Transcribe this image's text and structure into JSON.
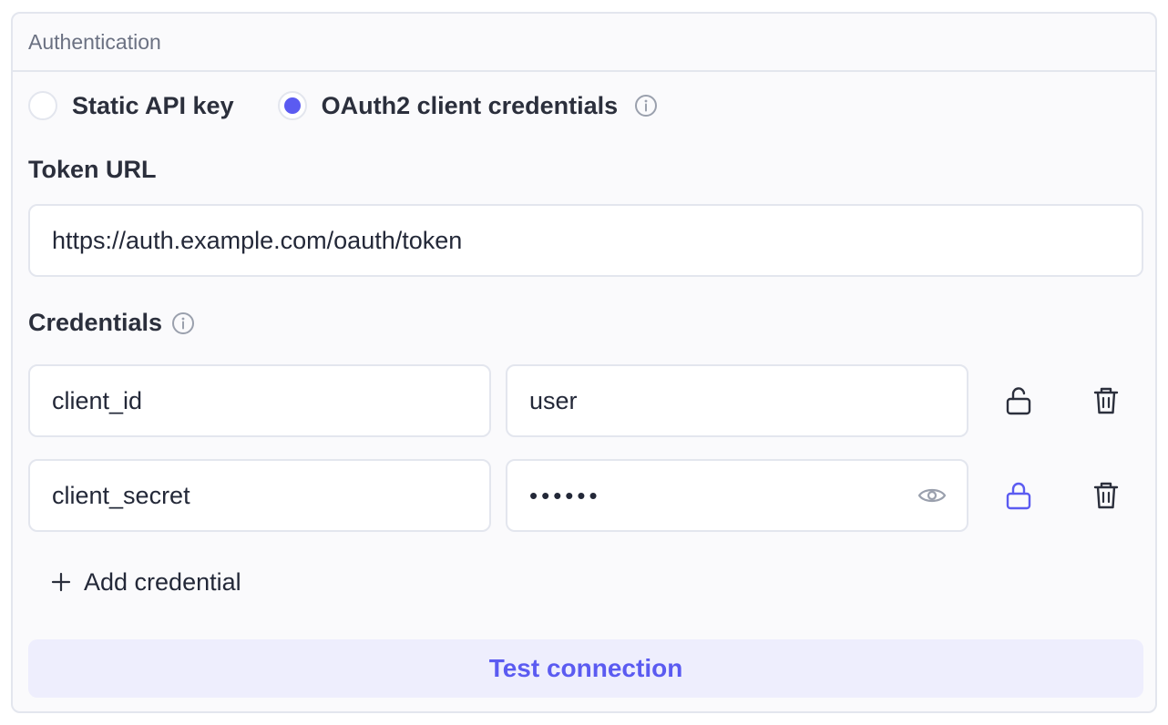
{
  "section": {
    "title": "Authentication"
  },
  "auth_mode": {
    "options": [
      {
        "label": "Static API key",
        "selected": false
      },
      {
        "label": "OAuth2 client credentials",
        "selected": true
      }
    ]
  },
  "token_url": {
    "label": "Token URL",
    "value": "https://auth.example.com/oauth/token"
  },
  "credentials": {
    "label": "Credentials",
    "rows": [
      {
        "key": "client_id",
        "value": "user",
        "masked": false,
        "lock_icon": "unlock-icon",
        "locked": false
      },
      {
        "key": "client_secret",
        "value": "••••••",
        "masked": true,
        "lock_icon": "lock-icon",
        "locked": true
      }
    ],
    "add_label": "Add credential"
  },
  "test_button": {
    "label": "Test connection"
  },
  "colors": {
    "accent": "#5b5bf1",
    "accent_bg": "#eeeefd",
    "border": "#e3e6ee",
    "muted": "#6b7182"
  }
}
